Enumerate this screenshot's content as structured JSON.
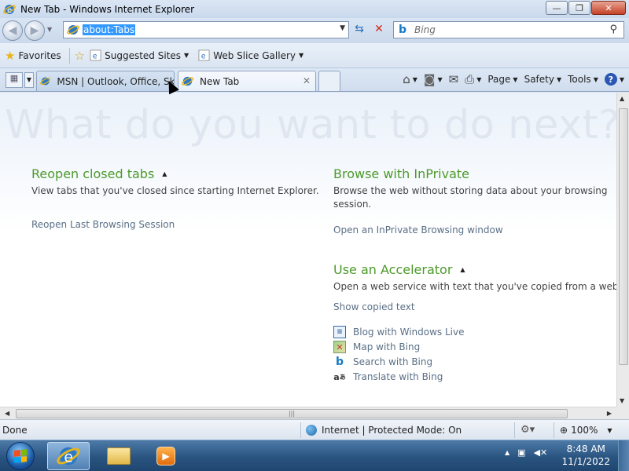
{
  "window": {
    "title": "New Tab - Windows Internet Explorer",
    "controls": {
      "minimize": "—",
      "maximize": "❐",
      "close": "✕"
    }
  },
  "address_bar": {
    "url": "about:Tabs",
    "search_placeholder": "Bing",
    "search_provider_icon": "bing-icon"
  },
  "favorites_bar": {
    "favorites_label": "Favorites",
    "items": [
      {
        "label": "Suggested Sites"
      },
      {
        "label": "Web Slice Gallery"
      }
    ]
  },
  "tabs": [
    {
      "label": "MSN | Outlook, Office, Sky...",
      "active": false
    },
    {
      "label": "New Tab",
      "active": true
    }
  ],
  "command_bar": {
    "page_label": "Page",
    "safety_label": "Safety",
    "tools_label": "Tools"
  },
  "content": {
    "hero": "What do you want to do next?",
    "reopen": {
      "title": "Reopen closed tabs",
      "description": "View tabs that you've closed since starting Internet Explorer.",
      "link": "Reopen Last Browsing Session"
    },
    "inprivate": {
      "title": "Browse with InPrivate",
      "description_line1": "Browse the web without storing data about your browsing",
      "description_line2": "session.",
      "link": "Open an InPrivate Browsing window"
    },
    "accelerator": {
      "title": "Use an Accelerator",
      "description": "Open a web service with text that you've copied from a webp",
      "show_copied": "Show copied text",
      "items": [
        {
          "label": "Blog with Windows Live",
          "icon": "windows-live-blog-icon"
        },
        {
          "label": "Map with Bing",
          "icon": "map-icon"
        },
        {
          "label": "Search with Bing",
          "icon": "bing-icon"
        },
        {
          "label": "Translate with Bing",
          "icon": "translate-icon"
        }
      ]
    }
  },
  "status_bar": {
    "status": "Done",
    "zone": "Internet | Protected Mode: On",
    "zoom": "100%"
  },
  "taskbar": {
    "time": "8:48 AM",
    "date": "11/1/2022"
  },
  "colors": {
    "section_heading": "#4c9a2a",
    "link": "#5a6f86",
    "url_selection": "#3399ff",
    "close_button": "#c54126"
  }
}
